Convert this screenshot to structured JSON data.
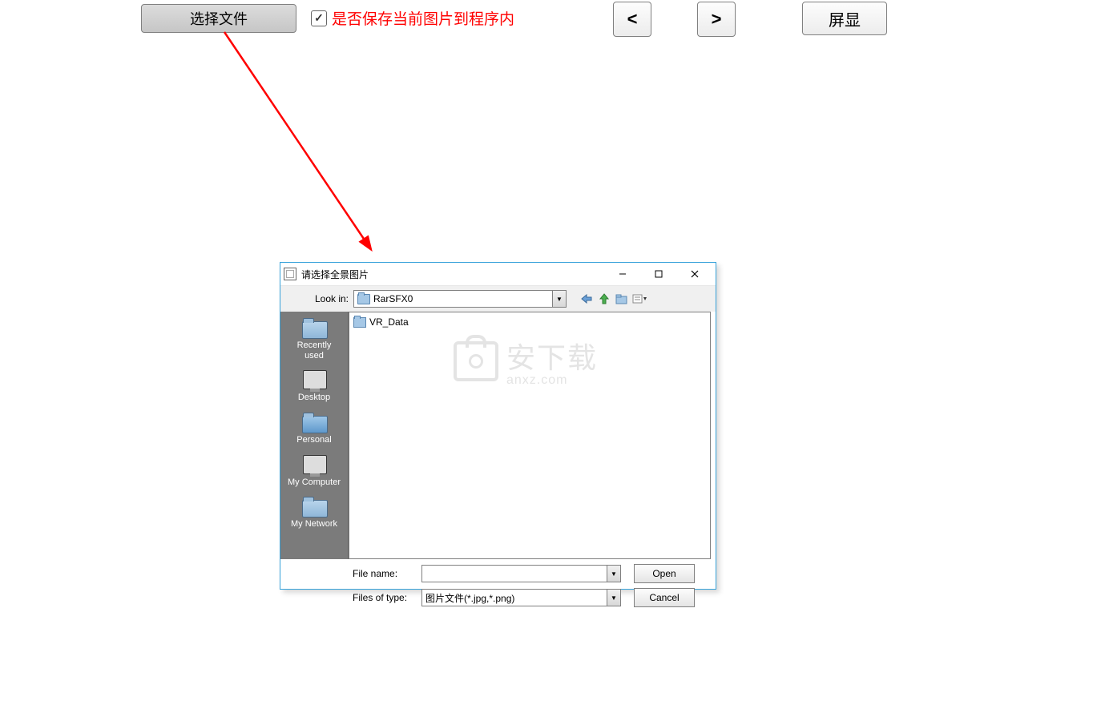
{
  "toolbar": {
    "select_file_label": "选择文件",
    "save_checkbox_label": "是否保存当前图片到程序内",
    "prev_label": "<",
    "next_label": ">",
    "display_label": "屏显"
  },
  "dialog": {
    "title": "请选择全景图片",
    "lookin_label": "Look in:",
    "lookin_value": "RarSFX0",
    "places": {
      "recently_used": "Recently\nused",
      "desktop": "Desktop",
      "personal": "Personal",
      "my_computer": "My Computer",
      "my_network": "My Network"
    },
    "file_items": [
      {
        "name": "VR_Data"
      }
    ],
    "filename_label": "File name:",
    "filename_value": "",
    "filetype_label": "Files of type:",
    "filetype_value": "图片文件(*.jpg,*.png)",
    "open_label": "Open",
    "cancel_label": "Cancel"
  },
  "watermark": {
    "zh": "安下载",
    "en": "anxz.com"
  }
}
